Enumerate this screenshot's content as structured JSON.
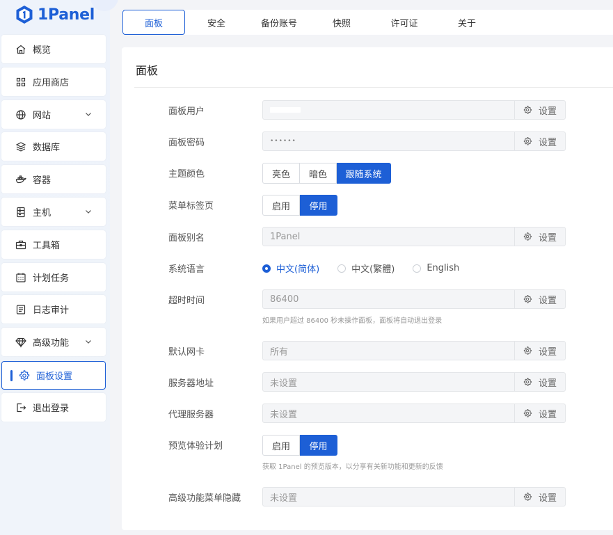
{
  "app": {
    "logo_text": "1Panel"
  },
  "sidebar": {
    "items": [
      {
        "label": "概览",
        "icon": "home-icon"
      },
      {
        "label": "应用商店",
        "icon": "grid-icon"
      },
      {
        "label": "网站",
        "icon": "globe-icon",
        "has_submenu": true
      },
      {
        "label": "数据库",
        "icon": "database-icon"
      },
      {
        "label": "容器",
        "icon": "docker-icon"
      },
      {
        "label": "主机",
        "icon": "server-icon",
        "has_submenu": true
      },
      {
        "label": "工具箱",
        "icon": "toolbox-icon"
      },
      {
        "label": "计划任务",
        "icon": "calendar-icon"
      },
      {
        "label": "日志审计",
        "icon": "log-icon"
      },
      {
        "label": "高级功能",
        "icon": "diamond-icon",
        "has_submenu": true
      },
      {
        "label": "面板设置",
        "icon": "gear-icon",
        "active": true
      },
      {
        "label": "退出登录",
        "icon": "logout-icon"
      }
    ]
  },
  "tabs": [
    {
      "label": "面板",
      "active": true
    },
    {
      "label": "安全"
    },
    {
      "label": "备份账号"
    },
    {
      "label": "快照"
    },
    {
      "label": "许可证"
    },
    {
      "label": "关于"
    }
  ],
  "panel": {
    "title": "面板",
    "setting_btn": "设置",
    "panel_user": {
      "label": "面板用户",
      "value": ""
    },
    "panel_password": {
      "label": "面板密码",
      "value": "••••••"
    },
    "theme": {
      "label": "主题颜色",
      "options": [
        "亮色",
        "暗色",
        "跟随系统"
      ],
      "selected": "跟随系统"
    },
    "menu_tabs": {
      "label": "菜单标签页",
      "options": [
        "启用",
        "停用"
      ],
      "selected": "停用"
    },
    "panel_alias": {
      "label": "面板别名",
      "value": "1Panel"
    },
    "language": {
      "label": "系统语言",
      "options": [
        "中文(简体)",
        "中文(繁體)",
        "English"
      ],
      "selected": "中文(简体)"
    },
    "timeout": {
      "label": "超时时间",
      "value": "86400",
      "hint": "如果用户超过 86400 秒未操作面板，面板将自动退出登录"
    },
    "nic": {
      "label": "默认网卡",
      "value": "所有"
    },
    "server_addr": {
      "label": "服务器地址",
      "value": "未设置"
    },
    "proxy": {
      "label": "代理服务器",
      "value": "未设置"
    },
    "preview": {
      "label": "预览体验计划",
      "options": [
        "启用",
        "停用"
      ],
      "selected": "停用",
      "hint": "获取 1Panel 的预览版本，以分享有关新功能和更新的反馈"
    },
    "hide_menu": {
      "label": "高级功能菜单隐藏",
      "value": "未设置"
    }
  },
  "colors": {
    "accent": "#1d5fd6"
  }
}
